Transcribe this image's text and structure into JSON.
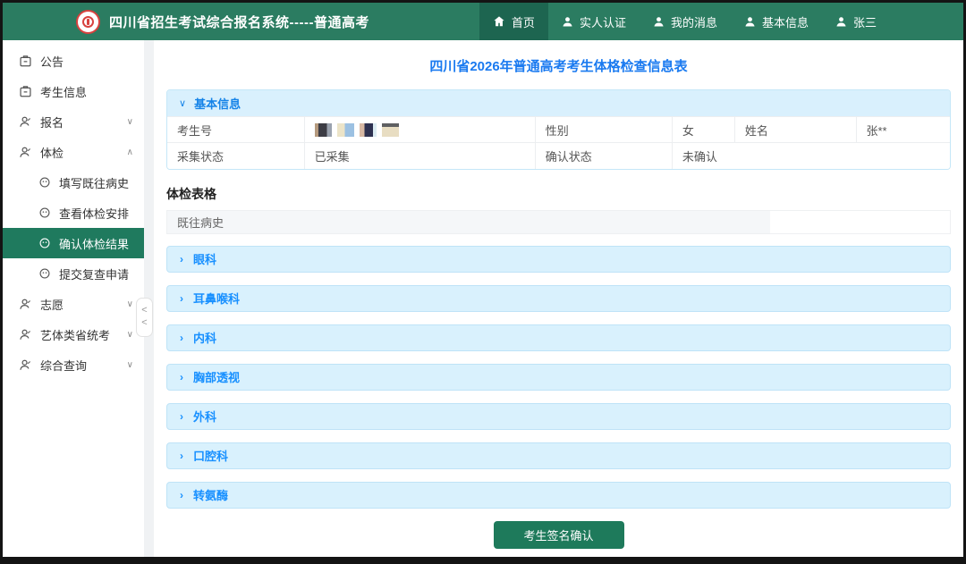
{
  "colors": {
    "header_green": "#2b7c61",
    "header_active_green": "#1d6550",
    "sidebar_active_green": "#1f7a5e",
    "accent_blue": "#1890ff",
    "title_blue": "#1a7af0",
    "accordion_bg": "#d9f1fd",
    "button_green": "#1e7a5b",
    "logo_red": "#d8423f"
  },
  "icons": {
    "chevron_right": "›",
    "chevron_down": "∨",
    "chevron_up": "∧",
    "collapse_left": "<"
  },
  "header": {
    "title": "四川省招生考试综合报名系统-----普通高考",
    "logo_icon": "emblem-icon",
    "nav": [
      {
        "label": "首页",
        "icon": "home-icon",
        "active": true
      },
      {
        "label": "实人认证",
        "icon": "user-icon",
        "active": false
      },
      {
        "label": "我的消息",
        "icon": "user-icon",
        "active": false
      },
      {
        "label": "基本信息",
        "icon": "user-icon",
        "active": false
      },
      {
        "label": "张三",
        "icon": "user-icon",
        "active": false
      }
    ]
  },
  "sidebar": {
    "items": [
      {
        "label": "公告",
        "icon": "badge-icon"
      },
      {
        "label": "考生信息",
        "icon": "badge-icon"
      },
      {
        "label": "报名",
        "icon": "user-icon",
        "chevron": "∨"
      },
      {
        "label": "体检",
        "icon": "user-icon",
        "chevron": "∧",
        "expanded": true
      },
      {
        "label": "填写既往病史",
        "icon": "circle-face-icon",
        "sub": true
      },
      {
        "label": "查看体检安排",
        "icon": "circle-face-icon",
        "sub": true
      },
      {
        "label": "确认体检结果",
        "icon": "circle-face-icon",
        "sub": true,
        "active": true
      },
      {
        "label": "提交复查申请",
        "icon": "circle-face-icon",
        "sub": true
      },
      {
        "label": "志愿",
        "icon": "user-icon",
        "chevron": "∨"
      },
      {
        "label": "艺体类省统考",
        "icon": "user-icon",
        "chevron": "∨"
      },
      {
        "label": "综合查询",
        "icon": "user-icon",
        "chevron": "∨"
      }
    ]
  },
  "main": {
    "page_title": "四川省2026年普通高考考生体格检查信息表",
    "basic_info": {
      "title": "基本信息",
      "fields": [
        {
          "label": "考生号",
          "value": "",
          "masked": true
        },
        {
          "label": "性别",
          "value": "女"
        },
        {
          "label": "姓名",
          "value": "张**"
        },
        {
          "label": "采集状态",
          "value": "已采集"
        },
        {
          "label": "确认状态",
          "value": "未确认"
        }
      ]
    },
    "exam_table_title": "体检表格",
    "history_label": "既往病史",
    "sections": [
      "眼科",
      "耳鼻喉科",
      "内科",
      "胸部透视",
      "外科",
      "口腔科",
      "转氨酶"
    ],
    "confirm_button_label": "考生签名确认"
  }
}
